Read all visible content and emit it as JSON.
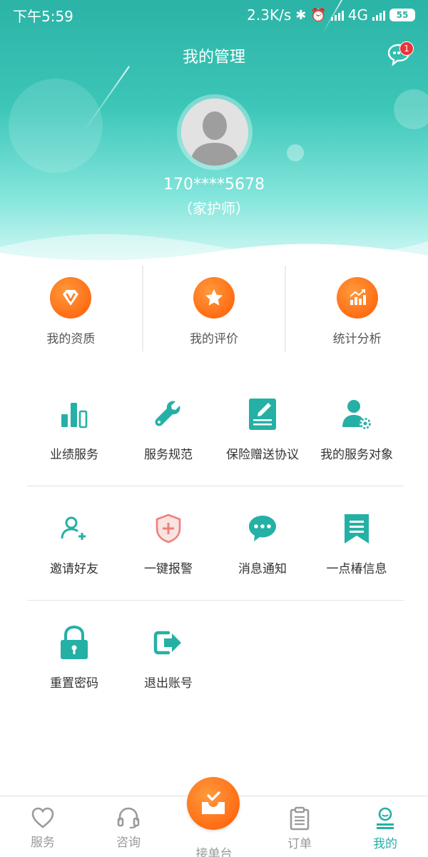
{
  "status_bar": {
    "time": "下午5:59",
    "net_speed": "2.3K/s",
    "network": "4G",
    "battery": "55"
  },
  "header": {
    "title": "我的管理",
    "message_badge": "1",
    "user_phone": "170****5678",
    "user_role": "（家护师）"
  },
  "top_cats": [
    {
      "label": "我的资质",
      "icon": "vip-badge-icon"
    },
    {
      "label": "我的评价",
      "icon": "star-icon"
    },
    {
      "label": "统计分析",
      "icon": "chart-trend-icon"
    }
  ],
  "grid": {
    "row1": [
      {
        "label": "业绩服务",
        "icon": "bar-chart-icon"
      },
      {
        "label": "服务规范",
        "icon": "wrench-icon"
      },
      {
        "label": "保险赠送协议",
        "icon": "document-pen-icon"
      },
      {
        "label": "我的服务对象",
        "icon": "user-gear-icon"
      }
    ],
    "row2": [
      {
        "label": "邀请好友",
        "icon": "user-add-icon"
      },
      {
        "label": "一键报警",
        "icon": "shield-cross-icon"
      },
      {
        "label": "消息通知",
        "icon": "chat-bubble-icon"
      },
      {
        "label": "一点椿信息",
        "icon": "bookmark-list-icon"
      }
    ],
    "row3": [
      {
        "label": "重置密码",
        "icon": "lock-icon"
      },
      {
        "label": "退出账号",
        "icon": "logout-icon"
      }
    ]
  },
  "tabbar": [
    {
      "label": "服务",
      "icon": "heart-icon",
      "active": false
    },
    {
      "label": "咨询",
      "icon": "headset-icon",
      "active": false
    },
    {
      "label": "接单台",
      "icon": "inbox-check-icon",
      "active": false
    },
    {
      "label": "订单",
      "icon": "clipboard-icon",
      "active": false
    },
    {
      "label": "我的",
      "icon": "profile-icon",
      "active": true
    }
  ],
  "colors": {
    "teal": "#25b0a5",
    "orange": "#ff7a1f",
    "badge_red": "#e8343a"
  }
}
